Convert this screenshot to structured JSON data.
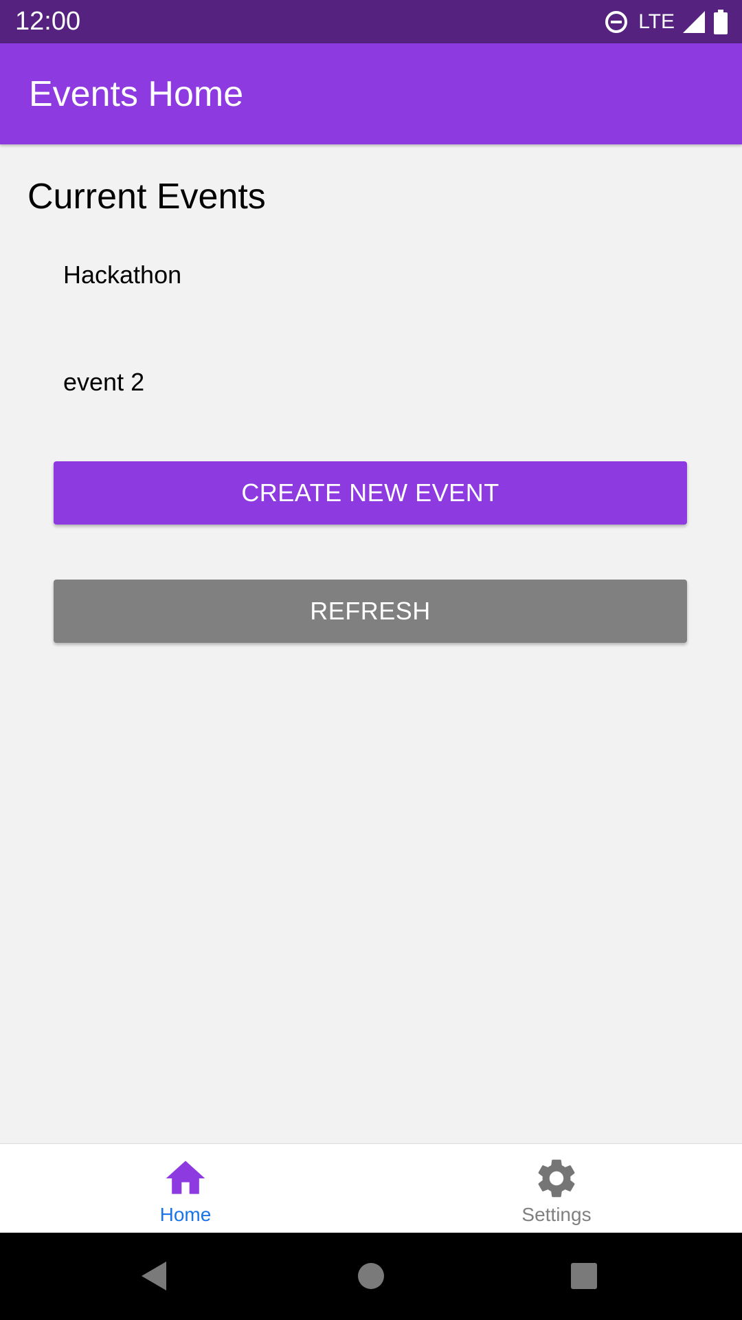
{
  "status_bar": {
    "time": "12:00",
    "network": "LTE",
    "icons": [
      "do-not-disturb-icon",
      "signal-icon",
      "battery-icon"
    ]
  },
  "app_bar": {
    "title": "Events Home"
  },
  "main": {
    "section_title": "Current Events",
    "events": [
      "Hackathon",
      "event 2"
    ],
    "create_button": "CREATE NEW EVENT",
    "refresh_button": "REFRESH"
  },
  "bottom_nav": {
    "items": [
      {
        "label": "Home",
        "icon": "home-icon",
        "selected": true
      },
      {
        "label": "Settings",
        "icon": "gear-icon",
        "selected": false
      }
    ]
  },
  "system_nav": {
    "icons": [
      "back-icon",
      "home-circle-icon",
      "recents-icon"
    ]
  },
  "colors": {
    "status_bar": "#55237f",
    "primary": "#8d3be0",
    "background": "#f2f2f2",
    "refresh_button": "#808080",
    "nav_selected_label": "#1a73e8",
    "nav_unselected": "#808080"
  }
}
